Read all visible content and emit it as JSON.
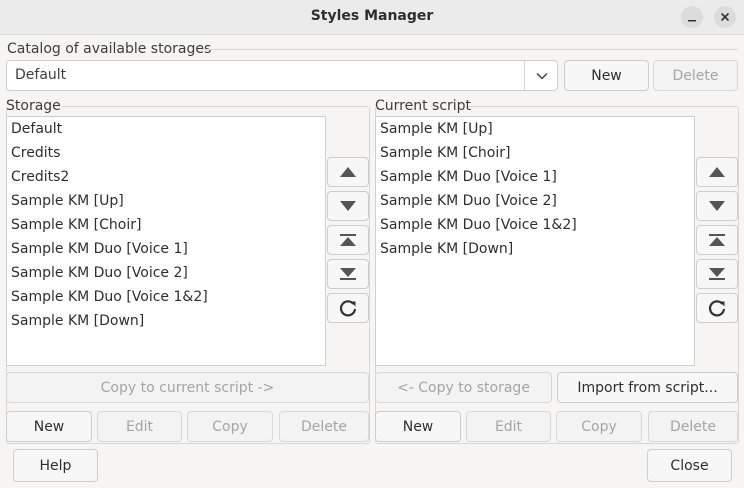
{
  "window": {
    "title": "Styles Manager"
  },
  "catalog": {
    "label": "Catalog of available storages",
    "selected": "Default",
    "new_label": "New",
    "delete_label": "Delete"
  },
  "storage": {
    "label": "Storage",
    "items": [
      "Default",
      "Credits",
      "Credits2",
      "Sample KM [Up]",
      "Sample KM [Choir]",
      "Sample KM Duo [Voice 1]",
      "Sample KM Duo [Voice 2]",
      "Sample KM Duo [Voice 1&2]",
      "Sample KM [Down]"
    ],
    "copy_label": "Copy to current script ->",
    "new_label": "New",
    "edit_label": "Edit",
    "copy_btn_label": "Copy",
    "delete_label": "Delete"
  },
  "script": {
    "label": "Current script",
    "items": [
      "Sample KM [Up]",
      "Sample KM [Choir]",
      "Sample KM Duo [Voice 1]",
      "Sample KM Duo [Voice 2]",
      "Sample KM Duo [Voice 1&2]",
      "Sample KM [Down]"
    ],
    "copy_label": "<- Copy to storage",
    "import_label": "Import from script...",
    "new_label": "New",
    "edit_label": "Edit",
    "copy_btn_label": "Copy",
    "delete_label": "Delete"
  },
  "footer": {
    "help_label": "Help",
    "close_label": "Close"
  },
  "icons": {
    "minimize": "minimize-icon",
    "close": "close-icon",
    "dropdown": "chevron-down-icon",
    "move_up": "triangle-up-icon",
    "move_down": "triangle-down-icon",
    "move_top": "move-to-top-icon",
    "move_bottom": "move-to-bottom-icon",
    "sort": "sort-icon"
  }
}
